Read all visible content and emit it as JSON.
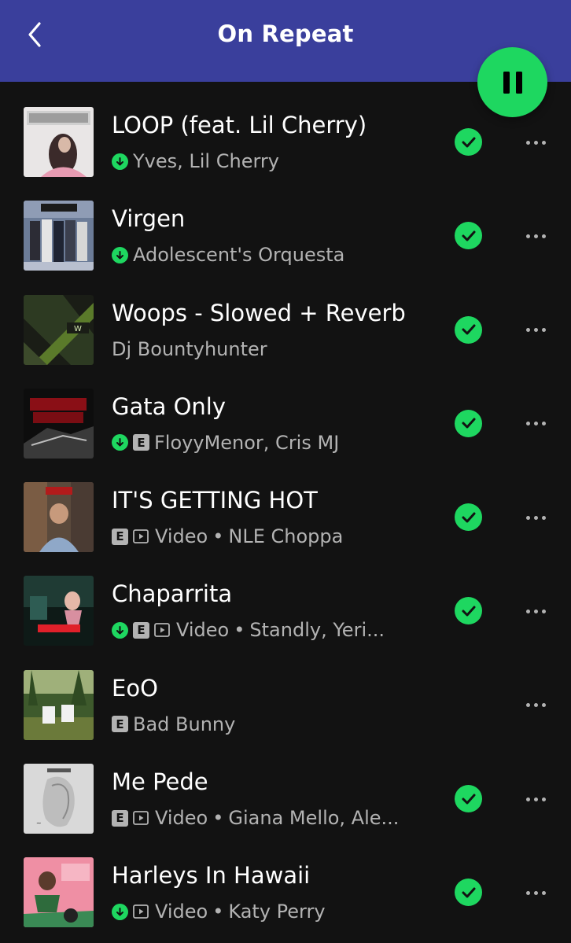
{
  "header": {
    "title": "On Repeat",
    "background": "#3a3f9c"
  },
  "colors": {
    "accent": "#1ed760",
    "secondary_text": "#b3b3b3",
    "background": "#121212"
  },
  "icons": {
    "back": "chevron-left-icon",
    "play_state": "pause-icon",
    "liked": "check-circle-icon",
    "more": "more-horizontal-icon",
    "downloaded": "download-arrow-icon",
    "explicit": "explicit-icon",
    "video": "video-play-icon"
  },
  "tracks": [
    {
      "title": "LOOP (feat. Lil Cherry)",
      "downloaded": true,
      "explicit": false,
      "video": false,
      "video_label": "",
      "separator": "",
      "artist": "Yves, Lil Cherry",
      "liked": true
    },
    {
      "title": "Virgen",
      "downloaded": true,
      "explicit": false,
      "video": false,
      "video_label": "",
      "separator": "",
      "artist": "Adolescent's Orquesta",
      "liked": true
    },
    {
      "title": "Woops - Slowed + Reverb",
      "downloaded": false,
      "explicit": false,
      "video": false,
      "video_label": "",
      "separator": "",
      "artist": "Dj Bountyhunter",
      "liked": true
    },
    {
      "title": "Gata Only",
      "downloaded": true,
      "explicit": true,
      "video": false,
      "video_label": "",
      "separator": "",
      "artist": "FloyyMenor, Cris MJ",
      "liked": true
    },
    {
      "title": "IT'S GETTING HOT",
      "downloaded": false,
      "explicit": true,
      "video": true,
      "video_label": "Video",
      "separator": "•",
      "artist": "NLE Choppa",
      "liked": true
    },
    {
      "title": "Chaparrita",
      "downloaded": true,
      "explicit": true,
      "video": true,
      "video_label": "Video",
      "separator": "•",
      "artist": "Standly, Yeri...",
      "liked": true
    },
    {
      "title": "EoO",
      "downloaded": false,
      "explicit": true,
      "video": false,
      "video_label": "",
      "separator": "",
      "artist": "Bad Bunny",
      "liked": false
    },
    {
      "title": "Me Pede",
      "downloaded": false,
      "explicit": true,
      "video": true,
      "video_label": "Video",
      "separator": "•",
      "artist": "Giana Mello, Ale...",
      "liked": true
    },
    {
      "title": "Harleys In Hawaii",
      "downloaded": true,
      "explicit": false,
      "video": true,
      "video_label": "Video",
      "separator": "•",
      "artist": "Katy Perry",
      "liked": true
    }
  ],
  "explicit_letter": "E"
}
